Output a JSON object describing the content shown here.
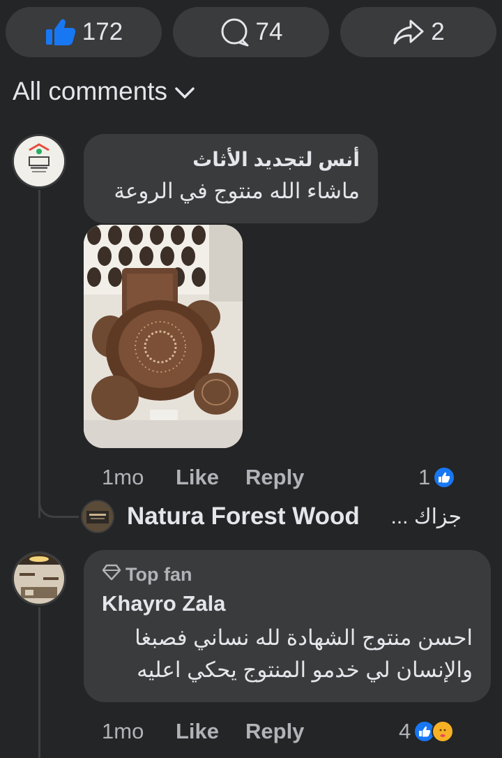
{
  "actions": {
    "like_count": "172",
    "comment_count": "74",
    "share_count": "2"
  },
  "comments_filter": "All comments",
  "comments": [
    {
      "author": "أنس لتجديد الأثاث",
      "text": "ماشاء الله منتوج في الروعة",
      "time": "1mo",
      "like_label": "Like",
      "reply_label": "Reply",
      "reaction_count": "1",
      "reply_preview": {
        "author": "Natura Forest Wood",
        "snippet": "جزاك ..."
      }
    },
    {
      "badge": "Top fan",
      "author": "Khayro Zala",
      "text_line1": "احسن منتوج الشهادة لله نساني فصبغا",
      "text_line2": "والإنسان لي خدمو المنتوج يحكي اعليه",
      "time": "1mo",
      "like_label": "Like",
      "reply_label": "Reply",
      "reaction_count": "4"
    }
  ],
  "colors": {
    "background": "#242526",
    "bubble": "#3a3b3c",
    "text": "#e4e6eb",
    "muted": "#b0b3b8",
    "like_blue": "#1877f2"
  }
}
